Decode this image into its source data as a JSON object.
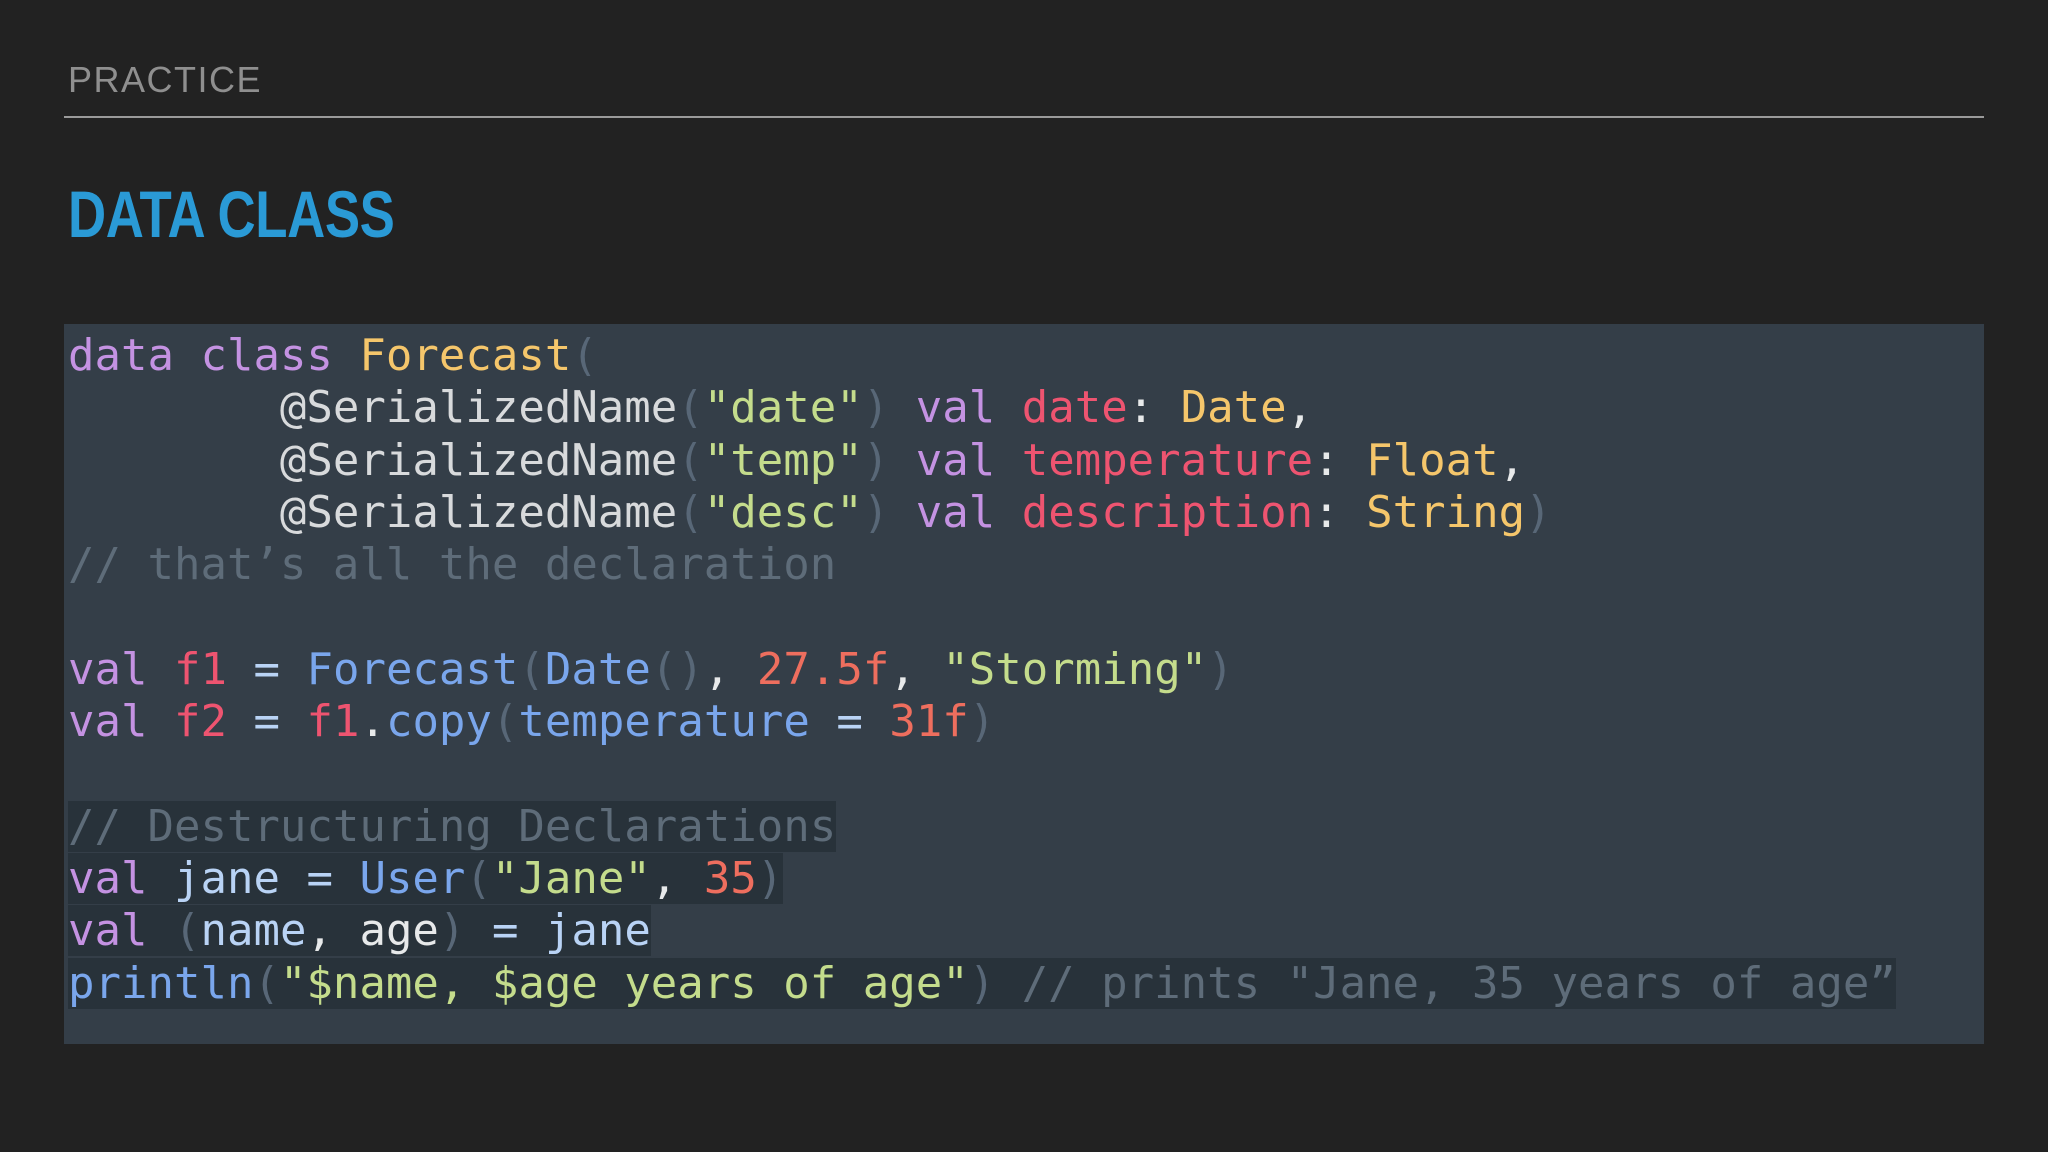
{
  "header": {
    "section_label": "PRACTICE",
    "title": "DATA CLASS"
  },
  "code": {
    "language": "kotlin",
    "lines": [
      "data class Forecast(",
      "        @SerializedName(\"date\") val date: Date,",
      "        @SerializedName(\"temp\") val temperature: Float,",
      "        @SerializedName(\"desc\") val description: String)",
      "// that’s all the declaration",
      "",
      "val f1 = Forecast(Date(), 27.5f, \"Storming\")",
      "val f2 = f1.copy(temperature = 31f)",
      "",
      "// Destructuring Declarations",
      "val jane = User(\"Jane\", 35)",
      "val (name, age) = jane",
      "println(\"$name, $age years of age\") // prints \"Jane, 35 years of age”"
    ]
  },
  "colors": {
    "background": "#222222",
    "code_background": "#343e48",
    "title": "#2a9ad6",
    "keyword": "#c492e2",
    "class_name": "#f5c66b",
    "string": "#c4dc8c",
    "property": "#ee5470",
    "comment": "#5e6c79",
    "function": "#7aa6ec",
    "number": "#ee6e5e"
  }
}
